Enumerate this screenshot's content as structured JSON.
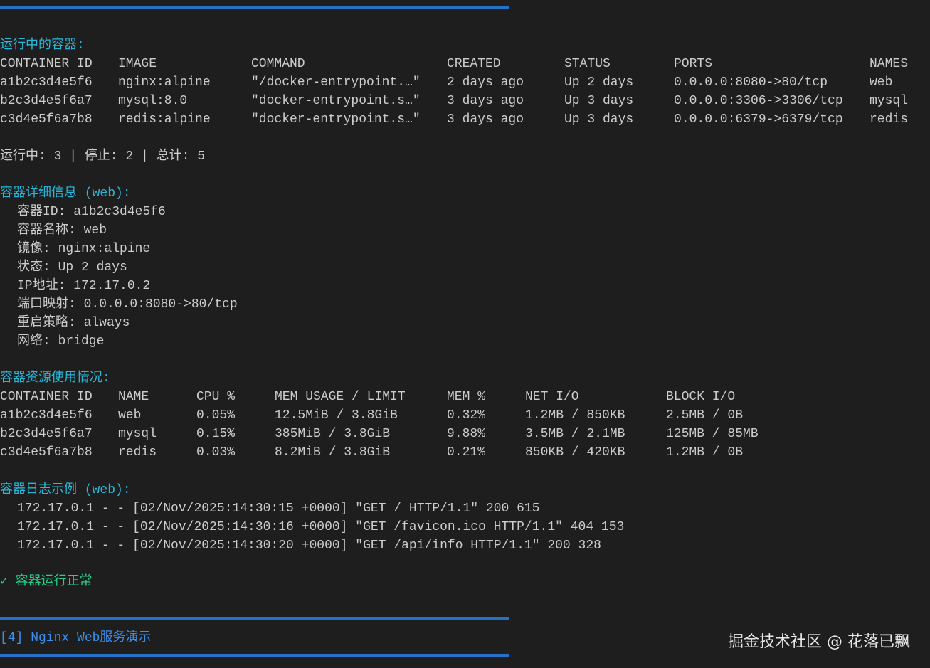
{
  "running_title": "运行中的容器:",
  "ps": {
    "headers": [
      "CONTAINER ID",
      "IMAGE",
      "COMMAND",
      "CREATED",
      "STATUS",
      "PORTS",
      "NAMES"
    ],
    "rows": [
      [
        "a1b2c3d4e5f6",
        "nginx:alpine",
        "\"/docker-entrypoint.…\"",
        "2 days ago",
        "Up 2 days",
        "0.0.0.0:8080->80/tcp",
        "web"
      ],
      [
        "b2c3d4e5f6a7",
        "mysql:8.0",
        "\"docker-entrypoint.s…\"",
        "3 days ago",
        "Up 3 days",
        "0.0.0.0:3306->3306/tcp",
        "mysql"
      ],
      [
        "c3d4e5f6a7b8",
        "redis:alpine",
        "\"docker-entrypoint.s…\"",
        "3 days ago",
        "Up 3 days",
        "0.0.0.0:6379->6379/tcp",
        "redis"
      ]
    ]
  },
  "summary": "运行中: 3 | 停止: 2 | 总计: 5",
  "detail_title": "容器详细信息 (web):",
  "details": [
    "容器ID: a1b2c3d4e5f6",
    "容器名称: web",
    "镜像: nginx:alpine",
    "状态: Up 2 days",
    "IP地址: 172.17.0.2",
    "端口映射: 0.0.0.0:8080->80/tcp",
    "重启策略: always",
    "网络: bridge"
  ],
  "stats_title": "容器资源使用情况:",
  "stats": {
    "headers": [
      "CONTAINER ID",
      "NAME",
      "CPU %",
      "MEM USAGE / LIMIT",
      "MEM %",
      "NET I/O",
      "BLOCK I/O"
    ],
    "rows": [
      [
        "a1b2c3d4e5f6",
        "web",
        "0.05%",
        "12.5MiB / 3.8GiB",
        "0.32%",
        "1.2MB / 850KB",
        "2.5MB / 0B"
      ],
      [
        "b2c3d4e5f6a7",
        "mysql",
        "0.15%",
        "385MiB / 3.8GiB",
        "9.88%",
        "3.5MB / 2.1MB",
        "125MB / 85MB"
      ],
      [
        "c3d4e5f6a7b8",
        "redis",
        "0.03%",
        "8.2MiB / 3.8GiB",
        "0.21%",
        "850KB / 420KB",
        "1.2MB / 0B"
      ]
    ]
  },
  "logs_title": "容器日志示例 (web):",
  "logs": [
    "172.17.0.1 - - [02/Nov/2025:14:30:15 +0000] \"GET / HTTP/1.1\" 200 615",
    "172.17.0.1 - - [02/Nov/2025:14:30:16 +0000] \"GET /favicon.ico HTTP/1.1\" 404 153",
    "172.17.0.1 - - [02/Nov/2025:14:30:20 +0000] \"GET /api/info HTTP/1.1\" 200 328"
  ],
  "ok": "✓ 容器运行正常",
  "next_section": "[4] Nginx Web服务演示",
  "watermark": "掘金技术社区 @ 花落已飘",
  "colors": {
    "bg": "#1e1e1e",
    "text": "#cccccc",
    "heading": "#29b8db",
    "success": "#23d18b",
    "bar": "#2472c8"
  }
}
